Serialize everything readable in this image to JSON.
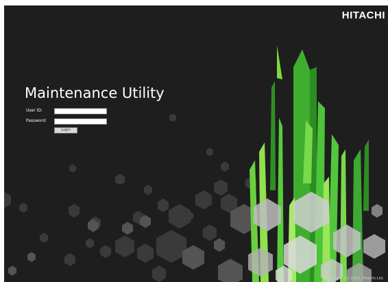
{
  "app": {
    "brand": "HITACHI",
    "title": "Maintenance Utility",
    "copyright": "Copyright (C) 2014, Hitachi,Ltd."
  },
  "login": {
    "user_id_label": "User ID:",
    "password_label": "Password:",
    "user_id_value": "",
    "password_value": "",
    "login_button": "Login"
  },
  "theme": {
    "background": "#1e1e1e",
    "accent": "#4ec43a",
    "accent_light": "#9be55a",
    "text": "#ffffff"
  }
}
